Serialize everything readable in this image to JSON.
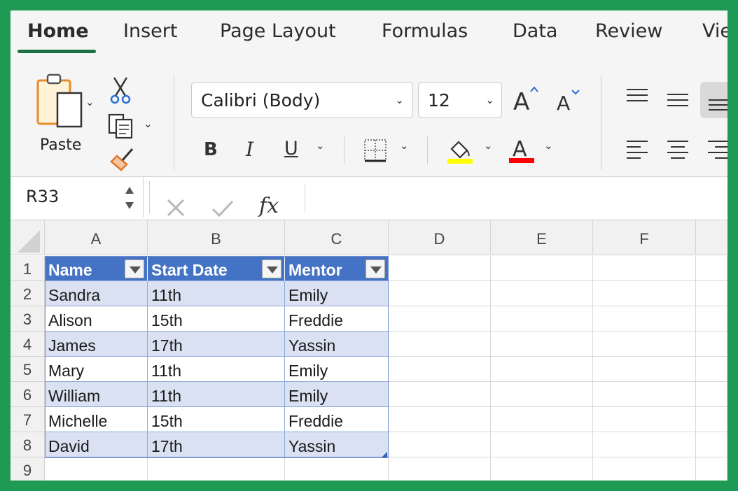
{
  "ribbon_tabs": [
    "Home",
    "Insert",
    "Page Layout",
    "Formulas",
    "Data",
    "Review",
    "Vie"
  ],
  "active_tab": "Home",
  "clipboard": {
    "paste_label": "Paste"
  },
  "font": {
    "name": "Calibri (Body)",
    "size": "12"
  },
  "format_buttons": {
    "bold": "B",
    "italic": "I",
    "underline": "U"
  },
  "colors": {
    "accent_green": "#1e7145",
    "border_green": "#1f9a55",
    "highlight_yellow": "#ffff00",
    "font_red": "#ff0000",
    "table_header_blue": "#4472c4",
    "table_band_blue": "#d9e1f2"
  },
  "icons": {
    "paste": "paste-icon",
    "cut": "scissors-icon",
    "copy": "copy-icon",
    "format_painter": "format-painter-icon",
    "increase_font": "increase-font-size-icon",
    "decrease_font": "decrease-font-size-icon",
    "borders": "borders-icon",
    "fill_color": "fill-color-icon",
    "font_color": "font-color-icon",
    "cancel": "cancel-x-icon",
    "enter": "checkmark-icon"
  },
  "formula_bar": {
    "name_box": "R33",
    "fx_label": "fx",
    "formula": ""
  },
  "grid": {
    "columns": [
      "A",
      "B",
      "C",
      "D",
      "E",
      "F"
    ],
    "rows": [
      "1",
      "2",
      "3",
      "4",
      "5",
      "6",
      "7",
      "8",
      "9"
    ]
  },
  "table": {
    "headers": [
      "Name",
      "Start Date",
      "Mentor"
    ],
    "rows": [
      [
        "Sandra",
        "11th",
        "Emily"
      ],
      [
        "Alison",
        "15th",
        "Freddie"
      ],
      [
        "James",
        "17th",
        "Yassin"
      ],
      [
        "Mary",
        "11th",
        "Emily"
      ],
      [
        "William",
        "11th",
        "Emily"
      ],
      [
        "Michelle",
        "15th",
        "Freddie"
      ],
      [
        "David",
        "17th",
        "Yassin"
      ]
    ]
  }
}
